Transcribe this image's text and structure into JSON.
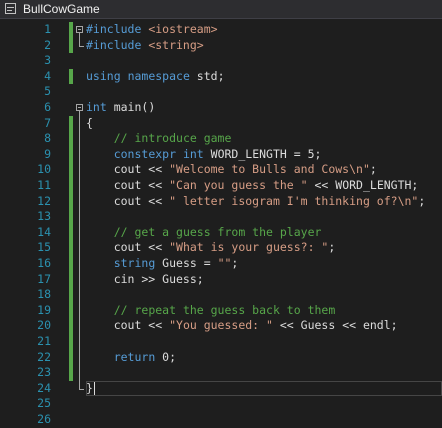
{
  "window": {
    "title": "BullCowGame",
    "project_icon": "cpp-project-icon"
  },
  "editor": {
    "line_numbers": [
      "1",
      "2",
      "3",
      "4",
      "5",
      "6",
      "7",
      "8",
      "9",
      "10",
      "11",
      "12",
      "13",
      "14",
      "15",
      "16",
      "17",
      "18",
      "19",
      "20",
      "21",
      "22",
      "23",
      "24",
      "25",
      "26"
    ],
    "lines": [
      [
        {
          "t": "#include ",
          "c": "kw"
        },
        {
          "t": "<iostream>",
          "c": "str"
        }
      ],
      [
        {
          "t": "#include ",
          "c": "kw"
        },
        {
          "t": "<string>",
          "c": "str"
        }
      ],
      [],
      [
        {
          "t": "using",
          "c": "kw"
        },
        {
          "t": " "
        },
        {
          "t": "namespace",
          "c": "kw"
        },
        {
          "t": " std;"
        }
      ],
      [],
      [
        {
          "t": "int",
          "c": "kw"
        },
        {
          "t": " main()"
        }
      ],
      [
        {
          "t": "{"
        }
      ],
      [
        {
          "t": "    "
        },
        {
          "t": "// introduce game",
          "c": "cmt"
        }
      ],
      [
        {
          "t": "    "
        },
        {
          "t": "constexpr",
          "c": "kw"
        },
        {
          "t": " "
        },
        {
          "t": "int",
          "c": "kw"
        },
        {
          "t": " WORD_LENGTH = 5;"
        }
      ],
      [
        {
          "t": "    cout << "
        },
        {
          "t": "\"Welcome to Bulls and Cows\\n\"",
          "c": "str"
        },
        {
          "t": ";"
        }
      ],
      [
        {
          "t": "    cout << "
        },
        {
          "t": "\"Can you guess the \"",
          "c": "str"
        },
        {
          "t": " << WORD_LENGTH;"
        }
      ],
      [
        {
          "t": "    cout << "
        },
        {
          "t": "\" letter isogram I'm thinking of?\\n\"",
          "c": "str"
        },
        {
          "t": ";"
        }
      ],
      [],
      [
        {
          "t": "    "
        },
        {
          "t": "// get a guess from the player",
          "c": "cmt"
        }
      ],
      [
        {
          "t": "    cout << "
        },
        {
          "t": "\"What is your guess?: \"",
          "c": "str"
        },
        {
          "t": ";"
        }
      ],
      [
        {
          "t": "    "
        },
        {
          "t": "string",
          "c": "kw"
        },
        {
          "t": " Guess = "
        },
        {
          "t": "\"\"",
          "c": "str"
        },
        {
          "t": ";"
        }
      ],
      [
        {
          "t": "    cin >> Guess;"
        }
      ],
      [],
      [
        {
          "t": "    "
        },
        {
          "t": "// repeat the guess back to them",
          "c": "cmt"
        }
      ],
      [
        {
          "t": "    cout << "
        },
        {
          "t": "\"You guessed: \"",
          "c": "str"
        },
        {
          "t": " << Guess << endl;"
        }
      ],
      [],
      [
        {
          "t": "    "
        },
        {
          "t": "return",
          "c": "kw"
        },
        {
          "t": " 0;"
        }
      ],
      [],
      [
        {
          "t": "}"
        }
      ],
      [],
      []
    ]
  },
  "colors": {
    "background": "#1e1e1e",
    "line_number": "#2b91af",
    "keyword": "#569cd6",
    "string": "#d69d85",
    "comment": "#57a64a",
    "text": "#dcdcdc",
    "change_marker": "#57a64a"
  }
}
